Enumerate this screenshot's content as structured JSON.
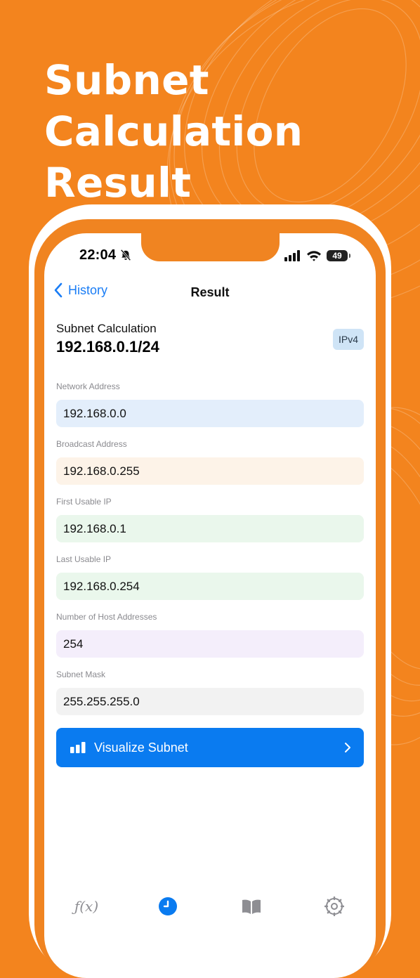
{
  "headline": {
    "line1": "Subnet",
    "line2": "Calculation",
    "line3": "Result"
  },
  "colors": {
    "background": "#f3841e",
    "accent_blue": "#0a7bf0",
    "network_bg": "#e3eefb",
    "broadcast_bg": "#fdf3e8",
    "first_ip_bg": "#eaf7ec",
    "last_ip_bg": "#eaf7ec",
    "hosts_bg": "#f4eefb",
    "mask_bg": "#f2f2f2"
  },
  "status_bar": {
    "time": "22:04",
    "battery": "49"
  },
  "navbar": {
    "back_label": "History",
    "title": "Result"
  },
  "calculation": {
    "label": "Subnet Calculation",
    "value": "192.168.0.1/24",
    "badge": "IPv4"
  },
  "fields": [
    {
      "label": "Network Address",
      "value": "192.168.0.0"
    },
    {
      "label": "Broadcast Address",
      "value": "192.168.0.255"
    },
    {
      "label": "First Usable IP",
      "value": "192.168.0.1"
    },
    {
      "label": "Last Usable IP",
      "value": "192.168.0.254"
    },
    {
      "label": "Number of Host Addresses",
      "value": "254"
    },
    {
      "label": "Subnet Mask",
      "value": "255.255.255.0"
    }
  ],
  "visualize_button": {
    "label": "Visualize Subnet"
  },
  "tabbar": {
    "function_tab": "ƒ(x)",
    "icons": [
      "function-icon",
      "clock-icon",
      "book-icon",
      "gear-icon"
    ]
  }
}
